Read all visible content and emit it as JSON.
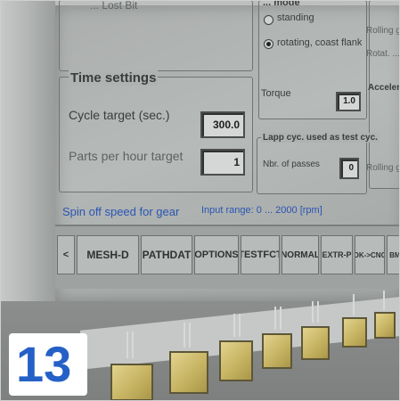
{
  "top_left": {
    "partial_text": "... Lost Bit"
  },
  "mode_panel": {
    "title": "... mode",
    "options": [
      {
        "label": "standing",
        "selected": false
      },
      {
        "label": "rotating, coast flank",
        "selected": true
      }
    ],
    "torque_label": "Torque",
    "torque_value": "1.0"
  },
  "time_settings": {
    "title": "Time settings",
    "cycle_label": "Cycle target (sec.)",
    "cycle_value": "300.0",
    "pph_label": "Parts per hour target",
    "pph_value": "1"
  },
  "lapp_panel": {
    "title": "Lapp cyc. used as test cyc.",
    "passes_label": "Nbr. of passes",
    "passes_value": "0"
  },
  "right_column": {
    "title": "Acceleration",
    "lines": [
      "Rolling gear ...",
      "Rotat. ...",
      "Rolling gear ..."
    ]
  },
  "hint": {
    "prefix": "Spin off speed for gear",
    "range": "Input range:  0 ... 2000  [rpm]"
  },
  "softkeys": [
    {
      "label": "<"
    },
    {
      "label": "MESH-D"
    },
    {
      "label": "PATHDAT"
    },
    {
      "label": "OPTIONS"
    },
    {
      "label": "TESTFCT"
    },
    {
      "label": "NORMAL"
    },
    {
      "label": "EXTR-P"
    },
    {
      "label": "OK->CNC"
    },
    {
      "label": "BMP"
    }
  ],
  "badge": {
    "number": "13"
  },
  "colors": {
    "hint_blue": "#2a55b5",
    "badge_blue": "#2560c7",
    "button_gold": "#c7b463"
  }
}
